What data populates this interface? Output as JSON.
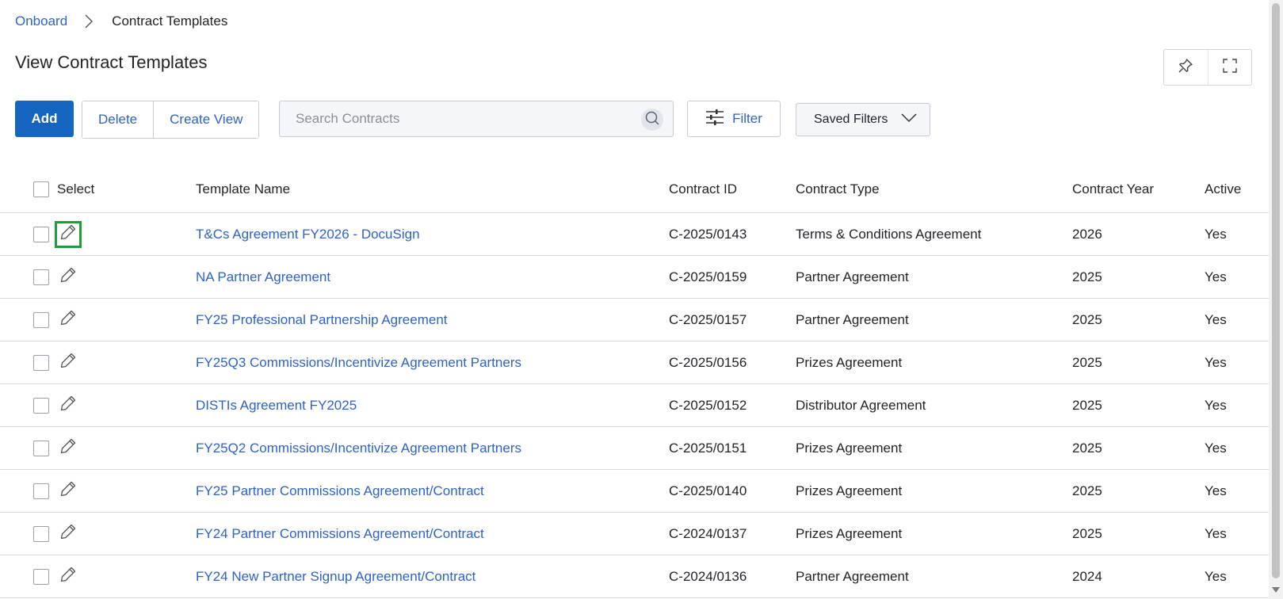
{
  "breadcrumb": {
    "root": "Onboard",
    "current": "Contract Templates"
  },
  "page": {
    "title": "View Contract Templates"
  },
  "toolbar": {
    "add_label": "Add",
    "delete_label": "Delete",
    "create_view_label": "Create View",
    "filter_label": "Filter",
    "saved_filters_label": "Saved Filters"
  },
  "search": {
    "placeholder": "Search Contracts",
    "value": ""
  },
  "table": {
    "headers": {
      "select": "Select",
      "name": "Template Name",
      "id": "Contract ID",
      "type": "Contract Type",
      "year": "Contract Year",
      "active": "Active"
    },
    "rows": [
      {
        "name": "T&Cs Agreement FY2026 - DocuSign",
        "id": "C-2025/0143",
        "type": "Terms & Conditions Agreement",
        "year": "2026",
        "active": "Yes"
      },
      {
        "name": "NA Partner Agreement",
        "id": "C-2025/0159",
        "type": "Partner Agreement",
        "year": "2025",
        "active": "Yes"
      },
      {
        "name": "FY25 Professional Partnership Agreement",
        "id": "C-2025/0157",
        "type": "Partner Agreement",
        "year": "2025",
        "active": "Yes"
      },
      {
        "name": "FY25Q3 Commissions/Incentivize Agreement Partners",
        "id": "C-2025/0156",
        "type": "Prizes Agreement",
        "year": "2025",
        "active": "Yes"
      },
      {
        "name": "DISTIs Agreement FY2025",
        "id": "C-2025/0152",
        "type": "Distributor Agreement",
        "year": "2025",
        "active": "Yes"
      },
      {
        "name": "FY25Q2 Commissions/Incentivize Agreement Partners",
        "id": "C-2025/0151",
        "type": "Prizes Agreement",
        "year": "2025",
        "active": "Yes"
      },
      {
        "name": "FY25 Partner Commissions Agreement/Contract",
        "id": "C-2025/0140",
        "type": "Prizes Agreement",
        "year": "2025",
        "active": "Yes"
      },
      {
        "name": "FY24 Partner Commissions Agreement/Contract",
        "id": "C-2024/0137",
        "type": "Prizes Agreement",
        "year": "2025",
        "active": "Yes"
      },
      {
        "name": "FY24 New Partner Signup Agreement/Contract",
        "id": "C-2024/0136",
        "type": "Partner Agreement",
        "year": "2024",
        "active": "Yes"
      }
    ]
  },
  "colors": {
    "link": "#2f62c6",
    "primary": "#1565c0",
    "focus": "#1e9e3a"
  }
}
